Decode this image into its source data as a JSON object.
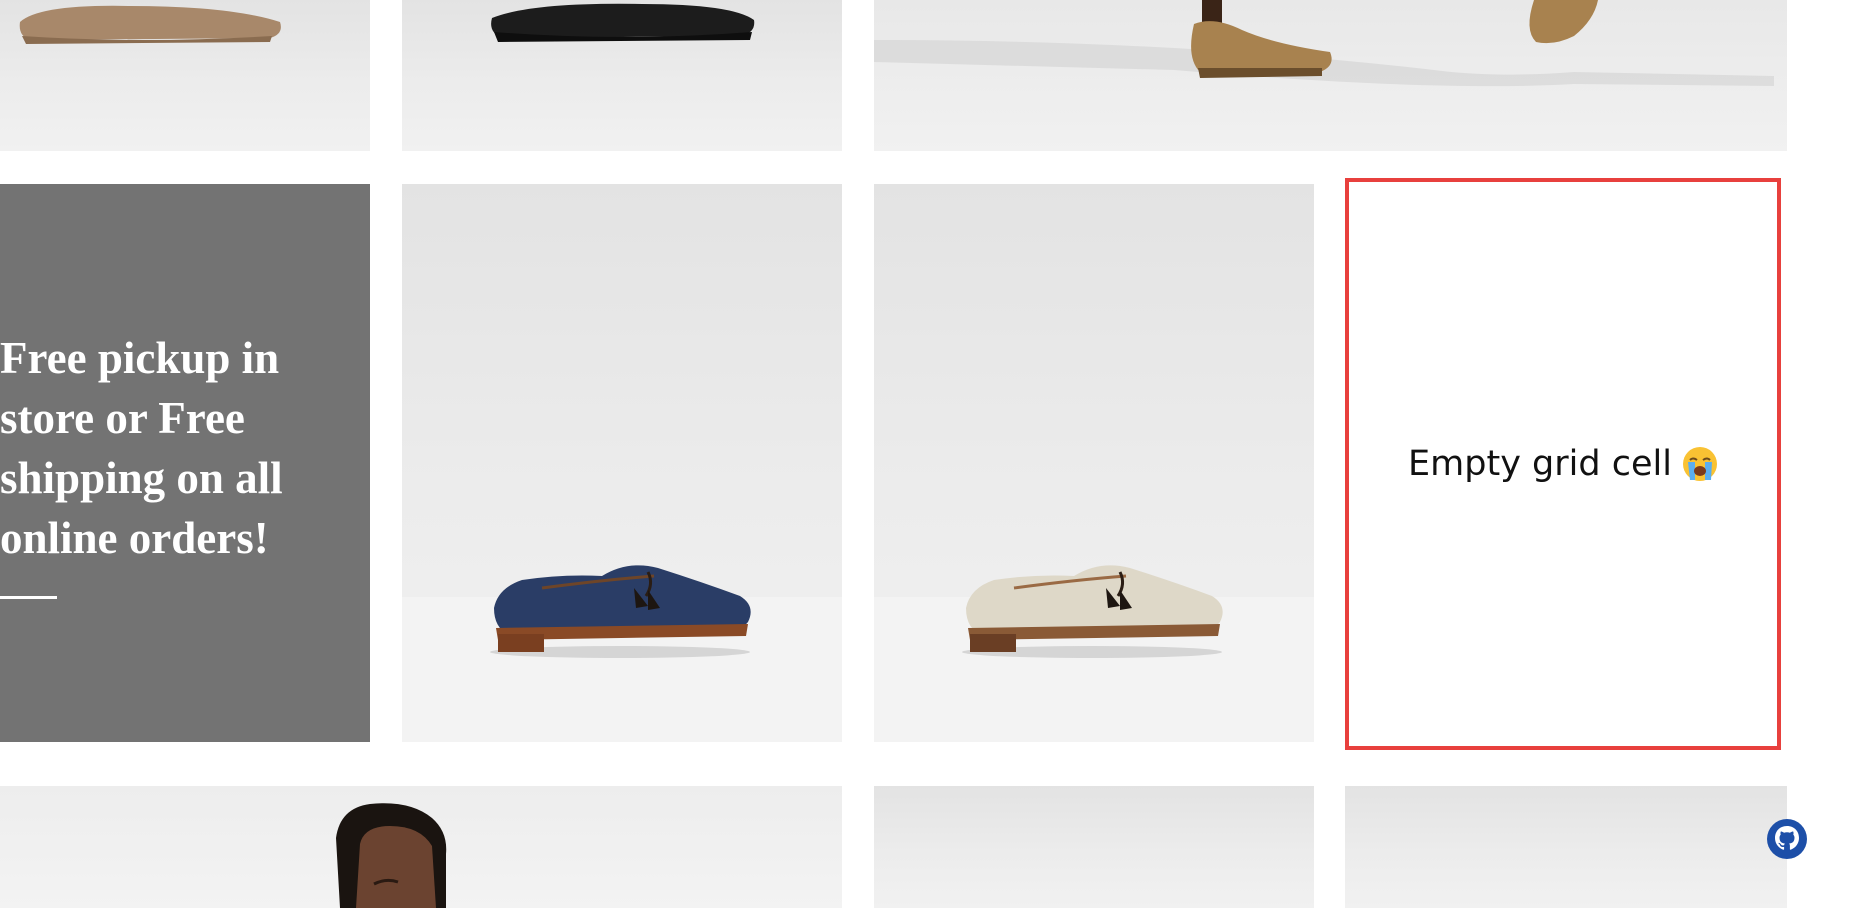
{
  "promo": {
    "text": "Free pickup in\nstore or Free\nshipping on all\nonline orders!"
  },
  "empty_cell": {
    "label": "Empty grid cell",
    "emoji_icon": "loudly-crying-face-icon"
  },
  "floating": {
    "icon": "github-icon",
    "color": "#1d4fa8"
  },
  "colors": {
    "promo_bg": "#737373",
    "empty_border": "#e8403d"
  }
}
